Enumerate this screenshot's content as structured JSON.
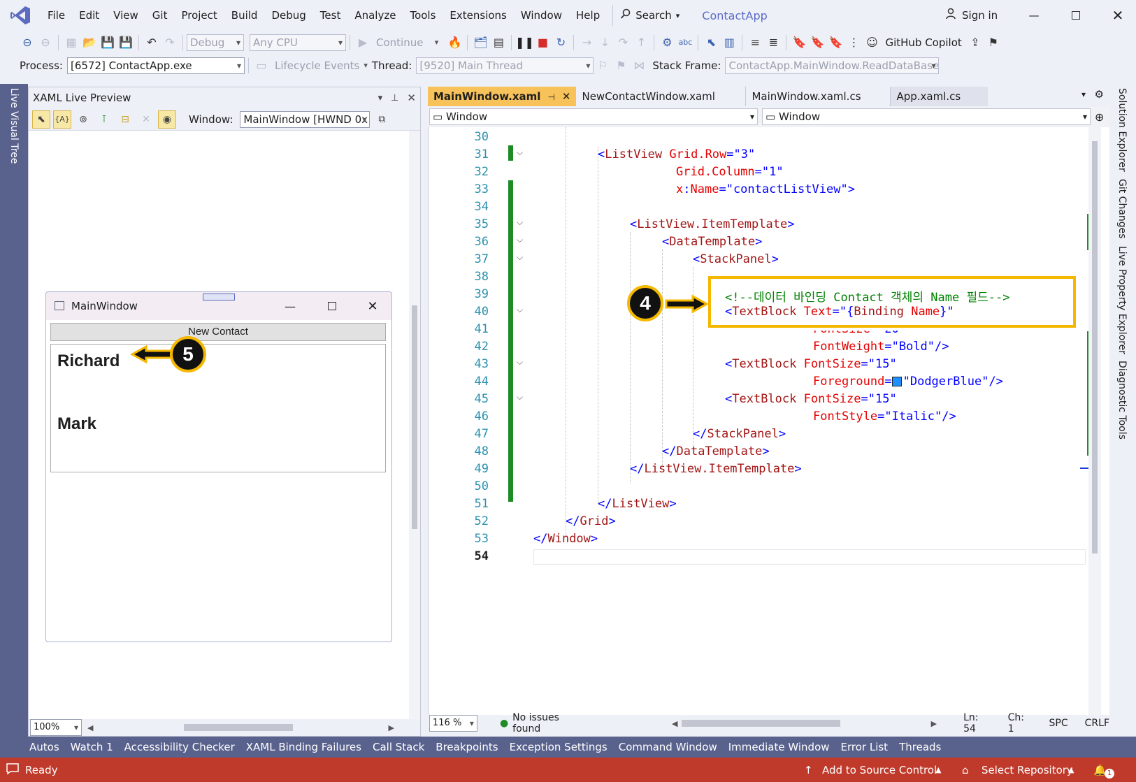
{
  "menu": {
    "items": [
      "File",
      "Edit",
      "View",
      "Git",
      "Project",
      "Build",
      "Debug",
      "Test",
      "Analyze",
      "Tools",
      "Extensions",
      "Window",
      "Help"
    ],
    "search_label": "Search",
    "app_title": "ContactApp",
    "sign_in": "Sign in"
  },
  "toolbar": {
    "config": "Debug",
    "platform": "Any CPU",
    "continue_label": "Continue",
    "copilot_label": "GitHub Copilot",
    "process_label": "Process:",
    "process_value": "[6572] ContactApp.exe",
    "lifecycle_label": "Lifecycle Events",
    "thread_label": "Thread:",
    "thread_value": "[9520] Main Thread",
    "stackframe_label": "Stack Frame:",
    "stackframe_value": "ContactApp.MainWindow.ReadDataBase"
  },
  "left_strip": {
    "tab": "Live Visual Tree"
  },
  "right_strip": {
    "tabs": [
      "Solution Explorer",
      "Git Changes",
      "Live Property Explorer",
      "Diagnostic Tools"
    ]
  },
  "preview": {
    "title": "XAML Live Preview",
    "window_label": "Window:",
    "window_value": "MainWindow [HWND 0x",
    "zoom": "100%",
    "mini_window": {
      "title": "MainWindow",
      "button": "New Contact",
      "contacts": [
        "Richard",
        "Mark"
      ]
    },
    "callout": "5"
  },
  "editor": {
    "tabs": [
      "MainWindow.xaml",
      "NewContactWindow.xaml",
      "MainWindow.xaml.cs",
      "App.xaml.cs"
    ],
    "nav_left": "Window",
    "nav_right": "Window",
    "callout": "4",
    "zoom": "116 %",
    "issues": "No issues found",
    "ln": "Ln: 54",
    "ch": "Ch: 1",
    "spc": "SPC",
    "crlf": "CRLF"
  },
  "tool_tabs": [
    "Autos",
    "Watch 1",
    "Accessibility Checker",
    "XAML Binding Failures",
    "Call Stack",
    "Breakpoints",
    "Exception Settings",
    "Command Window",
    "Immediate Window",
    "Error List",
    "Threads"
  ],
  "status": {
    "ready": "Ready",
    "source_control": "Add to Source Control",
    "repository": "Select Repository",
    "notifications": "1"
  },
  "colors": {
    "accent_tab": "#f7c25a",
    "status_bar": "#c03a2b",
    "side_strip": "#59628d",
    "callout": "#f5b800"
  }
}
